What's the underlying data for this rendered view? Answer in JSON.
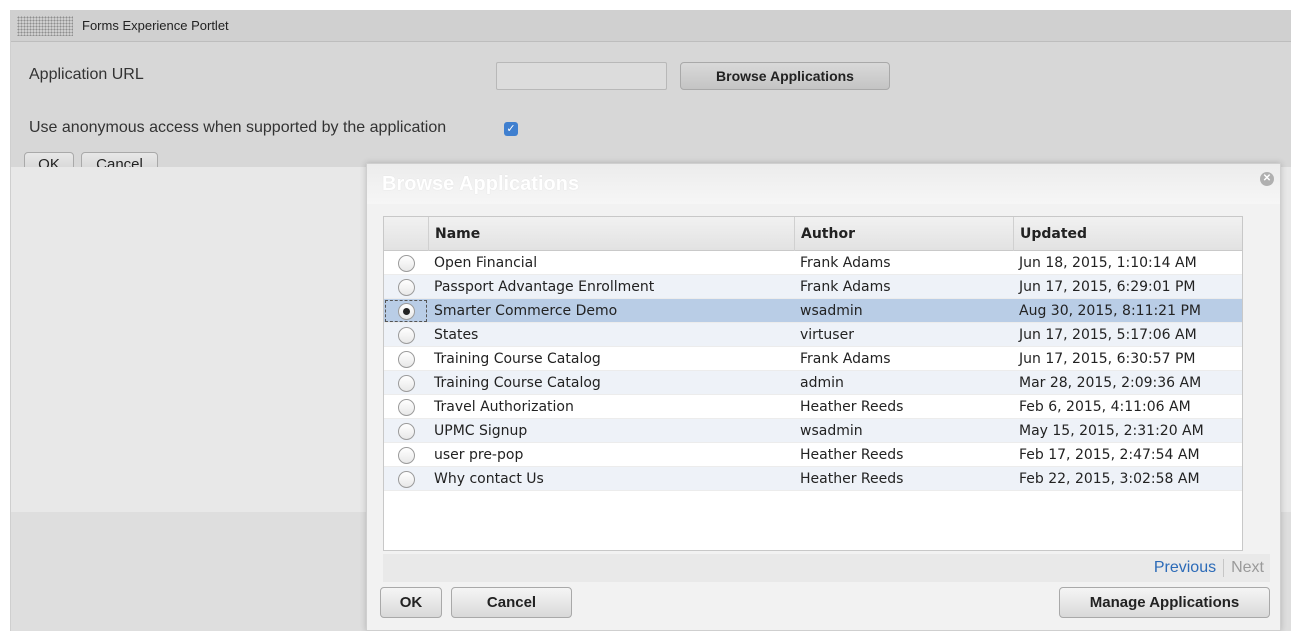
{
  "portlet": {
    "title": "Forms Experience Portlet",
    "app_url_label": "Application URL",
    "app_url_value": "",
    "browse_button": "Browse Applications",
    "anonymous_label": "Use anonymous access when supported by the application",
    "anonymous_checked": true,
    "ok_label": "OK",
    "cancel_label": "Cancel"
  },
  "dialog": {
    "title": "Browse Applications",
    "columns": [
      "Name",
      "Author",
      "Updated"
    ],
    "rows": [
      {
        "name": "Open Financial",
        "author": "Frank Adams",
        "updated": "Jun 18, 2015, 1:10:14 AM",
        "selected": false
      },
      {
        "name": "Passport Advantage Enrollment",
        "author": "Frank Adams",
        "updated": "Jun 17, 2015, 6:29:01 PM",
        "selected": false
      },
      {
        "name": "Smarter Commerce Demo",
        "author": "wsadmin",
        "updated": "Aug 30, 2015, 8:11:21 PM",
        "selected": true
      },
      {
        "name": "States",
        "author": "virtuser",
        "updated": "Jun 17, 2015, 5:17:06 AM",
        "selected": false
      },
      {
        "name": "Training Course Catalog",
        "author": "Frank Adams",
        "updated": "Jun 17, 2015, 6:30:57 PM",
        "selected": false
      },
      {
        "name": "Training Course Catalog",
        "author": "admin",
        "updated": "Mar 28, 2015, 2:09:36 AM",
        "selected": false
      },
      {
        "name": "Travel Authorization",
        "author": "Heather Reeds",
        "updated": "Feb 6, 2015, 4:11:06 AM",
        "selected": false
      },
      {
        "name": "UPMC Signup",
        "author": "wsadmin",
        "updated": "May 15, 2015, 2:31:20 AM",
        "selected": false
      },
      {
        "name": "user pre-pop",
        "author": "Heather Reeds",
        "updated": "Feb 17, 2015, 2:47:54 AM",
        "selected": false
      },
      {
        "name": "Why contact Us",
        "author": "Heather Reeds",
        "updated": "Feb 22, 2015, 3:02:58 AM",
        "selected": false
      }
    ],
    "pager": {
      "previous": "Previous",
      "next": "Next"
    },
    "ok_label": "OK",
    "cancel_label": "Cancel",
    "manage_label": "Manage Applications"
  },
  "icons": {
    "drag_handle": "drag-handle-icon",
    "close": "close-icon",
    "checkbox": "checkmark-icon"
  },
  "colors": {
    "selected_row": "#b9cde6",
    "link": "#2c6bb8",
    "checkbox": "#3f7fcf"
  }
}
